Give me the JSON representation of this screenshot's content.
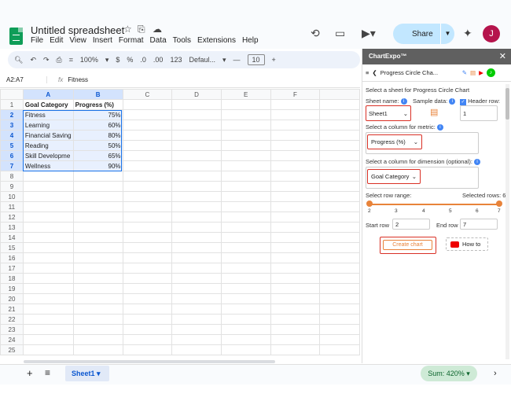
{
  "app": {
    "title": "Untitled spreadsheet",
    "menus": [
      "File",
      "Edit",
      "View",
      "Insert",
      "Format",
      "Data",
      "Tools",
      "Extensions",
      "Help"
    ],
    "share_label": "Share",
    "avatar_letter": "J"
  },
  "toolbar": {
    "zoom": "100%",
    "currency": "$",
    "percent": "%",
    "dec_decrease": ".0",
    "dec_increase": ".00",
    "number_format": "123",
    "font": "Defaul...",
    "font_size": "10"
  },
  "formula": {
    "name_box": "A2:A7",
    "fx": "fx",
    "value": "Fitness"
  },
  "grid": {
    "columns": [
      "A",
      "B",
      "C",
      "D",
      "E",
      "F"
    ],
    "rows": [
      [
        "Goal Category",
        "Progress (%)"
      ],
      [
        "Fitness",
        "75%"
      ],
      [
        "Learning",
        "60%"
      ],
      [
        "Financial Saving",
        "80%"
      ],
      [
        "Reading",
        "50%"
      ],
      [
        "Skill Developme",
        "65%"
      ],
      [
        "Wellness",
        "90%"
      ]
    ],
    "row_count": 25
  },
  "bottom": {
    "sheet_tab": "Sheet1",
    "sum": "Sum: 420%"
  },
  "panel": {
    "header": "ChartExpo™",
    "chart_name": "Progress Circle Cha...",
    "select_sheet_label": "Select a sheet for Progress Circle Chart",
    "sheet_name_label": "Sheet name:",
    "sample_data_label": "Sample data:",
    "header_row_label": "Header row:",
    "sheet_value": "Sheet1",
    "header_row_value": "1",
    "metric_label": "Select a column for metric:",
    "metric_value": "Progress (%)",
    "dimension_label": "Select a column for dimension (optional):",
    "dimension_value": "Goal Category",
    "row_range_label": "Select row range:",
    "selected_rows": "Selected rows: 6",
    "range_ticks": [
      "2",
      "3",
      "4",
      "5",
      "6",
      "7"
    ],
    "start_row_label": "Start row",
    "start_row": "2",
    "end_row_label": "End row",
    "end_row": "7",
    "create_button": "Create chart",
    "howto_button": "How to"
  }
}
